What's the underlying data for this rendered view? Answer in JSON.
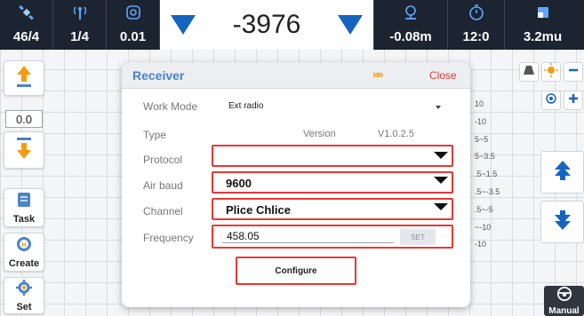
{
  "status_bar": {
    "satellites": "46/4",
    "radio": "1/4",
    "precision": "0.01",
    "main_value": "-3976",
    "offset": "-0.08m",
    "time": "12:0",
    "distance": "3.2mu"
  },
  "left_toolbar": {
    "value": "0.0",
    "task_label": "Task",
    "create_label": "Create",
    "set_label": "Set"
  },
  "right_toolbar": {
    "manual_label": "Manual"
  },
  "background_values": [
    "10",
    "-10",
    "5~5",
    "5~3.5",
    ".5~1.5",
    ".5~-3.5",
    ".5~-5",
    "~-10",
    "-10"
  ],
  "dialog": {
    "title": "Receiver",
    "chevrons": "»»",
    "close_label": "Close",
    "work_mode_label": "Work Mode",
    "work_mode_value": "Ext radio",
    "type_label": "Type",
    "version_label": "Version",
    "version_value": "V1.0.2.5",
    "protocol_label": "Protocol",
    "protocol_value": "",
    "air_baud_label": "Air baud",
    "air_baud_value": "9600",
    "channel_label": "Channel",
    "channel_value": "Plice Chlice",
    "frequency_label": "Frequency",
    "frequency_value": "458.05",
    "set_label": "SET",
    "configure_label": "Configure"
  },
  "colors": {
    "accent_blue": "#1565c0",
    "title_blue": "#4a83c9",
    "highlight_red": "#e53935",
    "close_red": "#e53935",
    "chevron_orange": "#f39c12",
    "topbar_bg": "#1b2430",
    "arrow_orange": "#f39c12"
  },
  "icons": [
    "satellite-icon",
    "radio-antenna-icon",
    "precision-target-icon",
    "offset-icon",
    "clock-icon",
    "distance-icon",
    "arrow-up-icon",
    "arrow-down-icon",
    "task-icon",
    "create-icon",
    "settings-icon",
    "cone-icon",
    "sun-icon",
    "minus-icon",
    "locate-icon",
    "plus-icon",
    "steering-wheel-icon"
  ]
}
